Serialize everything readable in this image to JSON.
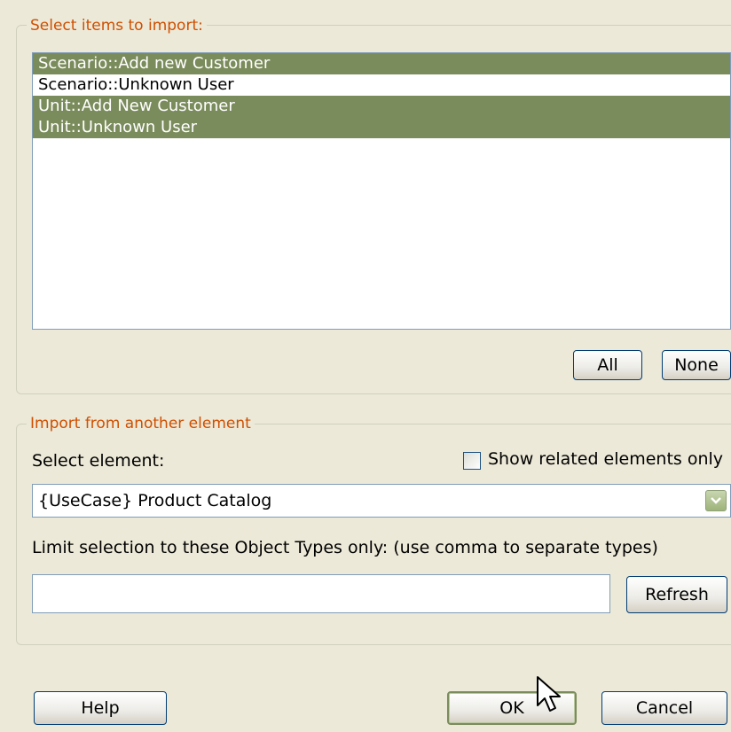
{
  "select_group": {
    "title": "Select items to import:",
    "items": [
      {
        "label": "Scenario::Add new Customer",
        "selected": true
      },
      {
        "label": "Scenario::Unknown User",
        "selected": false
      },
      {
        "label": "Unit::Add New Customer",
        "selected": true
      },
      {
        "label": "Unit::Unknown User",
        "selected": true
      }
    ],
    "all_label": "All",
    "none_label": "None"
  },
  "import_group": {
    "title": "Import from another element",
    "select_element_label": "Select element:",
    "show_related_label": "Show related elements only",
    "show_related_checked": false,
    "element_value": "{UseCase} Product Catalog",
    "limit_label": "Limit selection to these Object Types only: (use comma to separate types)",
    "object_types_value": "",
    "refresh_label": "Refresh"
  },
  "footer": {
    "help_label": "Help",
    "ok_label": "OK",
    "cancel_label": "Cancel"
  },
  "icons": {
    "dropdown": "chevron-down-icon",
    "cursor": "mouse-pointer-icon"
  },
  "colors": {
    "selection": "#7b8c5c",
    "group_title": "#d04f00",
    "background": "#ece9d8"
  }
}
